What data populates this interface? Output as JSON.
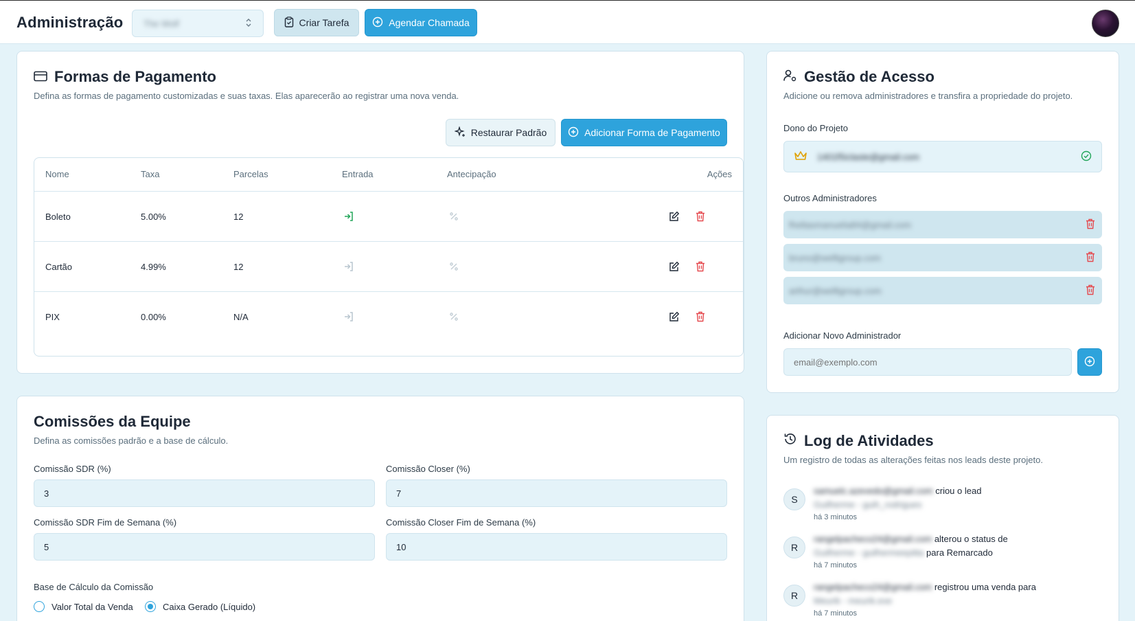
{
  "header": {
    "title": "Administração",
    "project_select": "The Wolf",
    "create_task": "Criar Tarefa",
    "schedule_call": "Agendar Chamada"
  },
  "payments": {
    "title": "Formas de Pagamento",
    "subtitle": "Defina as formas de pagamento customizadas e suas taxas. Elas aparecerão ao registrar uma nova venda.",
    "restore_label": "Restaurar Padrão",
    "add_label": "Adicionar Forma de Pagamento",
    "columns": [
      "Nome",
      "Taxa",
      "Parcelas",
      "Entrada",
      "Antecipação",
      "Ações"
    ],
    "rows": [
      {
        "name": "Boleto",
        "fee": "5.00%",
        "installments": "12",
        "entry_active": true
      },
      {
        "name": "Cartão",
        "fee": "4.99%",
        "installments": "12",
        "entry_active": false
      },
      {
        "name": "PIX",
        "fee": "0.00%",
        "installments": "N/A",
        "entry_active": false
      }
    ]
  },
  "commissions": {
    "title": "Comissões da Equipe",
    "subtitle": "Defina as comissões padrão e a base de cálculo.",
    "sdr_label": "Comissão SDR (%)",
    "sdr_value": "3",
    "closer_label": "Comissão Closer (%)",
    "closer_value": "7",
    "sdr_weekend_label": "Comissão SDR Fim de Semana (%)",
    "sdr_weekend_value": "5",
    "closer_weekend_label": "Comissão Closer Fim de Semana (%)",
    "closer_weekend_value": "10",
    "base_label": "Base de Cálculo da Comissão",
    "base_options": [
      "Valor Total da Venda",
      "Caixa Gerado (Líquido)"
    ],
    "base_selected": "Caixa Gerado (Líquido)"
  },
  "access": {
    "title": "Gestão de Acesso",
    "subtitle": "Adicione ou remova administradores e transfira a propriedade do projeto.",
    "owner_label": "Dono do Projeto",
    "owner_email": "1401f5iclaste@gmail.com",
    "others_label": "Outros Administradores",
    "admins": [
      "fheltasmanuelia84@gmail.com",
      "bruno@welltgroup.com",
      "arthur@welltgroup.com"
    ],
    "add_label": "Adicionar Novo Administrador",
    "add_placeholder": "email@exemplo.com"
  },
  "log": {
    "title": "Log de Atividades",
    "subtitle": "Um registro de todas as alterações feitas nos leads deste projeto.",
    "items": [
      {
        "initial": "S",
        "user": "samuelc.azevedo@gmail.com",
        "action": "criou o lead",
        "target": "Guilherme - guih_rodrigues",
        "suffix": "",
        "time": "há 3 minutos"
      },
      {
        "initial": "R",
        "user": "rangelpacheco24@gmail.com",
        "action": "alterou o status de",
        "target": "Guilherme - guilhermeepitta",
        "suffix": "para Remarcado",
        "time": "há 7 minutos"
      },
      {
        "initial": "R",
        "user": "rangelpacheco24@gmail.com",
        "action": "registrou uma venda para",
        "target": "Meurik - meurik.exe",
        "suffix": "",
        "time": "há 7 minutos"
      }
    ]
  },
  "colors": {
    "primary": "#2ea3dc",
    "danger": "#e5484d",
    "success": "#22a559",
    "crown": "#e0a100",
    "background": "#e4f3f9"
  }
}
